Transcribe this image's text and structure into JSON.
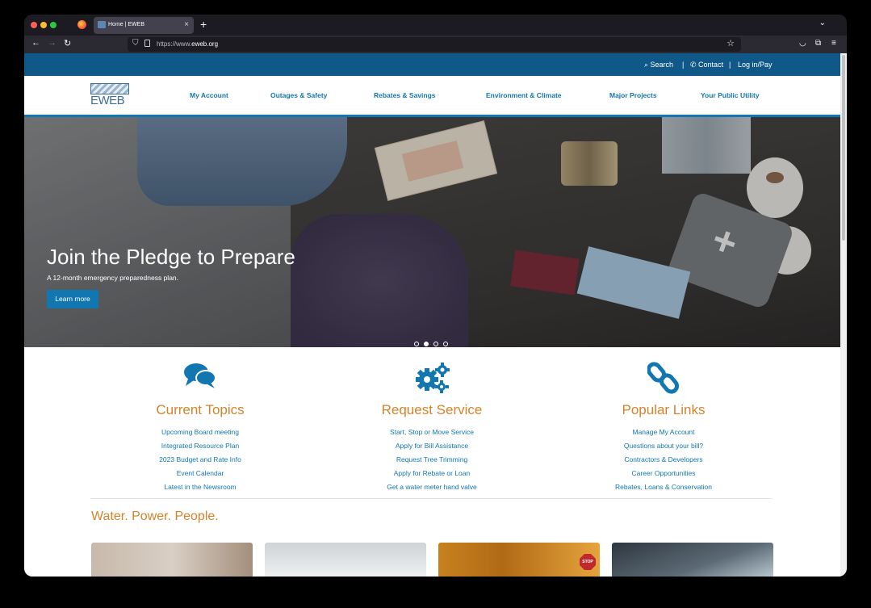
{
  "browser": {
    "tab_title": "Home | EWEB",
    "url_prefix": "https://www.",
    "url_domain": "eweb.org"
  },
  "utility_bar": {
    "search": "Search",
    "contact": "Contact",
    "login": "Log in/Pay",
    "separator": "|"
  },
  "logo": {
    "text": "EWEB"
  },
  "main_nav": [
    "My Account",
    "Outages & Safety",
    "Rebates & Savings",
    "Environment & Climate",
    "Major Projects",
    "Your Public Utility"
  ],
  "hero": {
    "title": "Join the Pledge to Prepare",
    "subtitle": "A 12-month emergency preparedness plan.",
    "button": "Learn more",
    "slide_count": 4,
    "active_slide": 2
  },
  "columns": [
    {
      "icon": "chat-bubbles-icon",
      "title": "Current Topics",
      "links": [
        "Upcoming Board meeting",
        "Integrated Resource Plan",
        "2023 Budget and Rate Info",
        "Event Calendar",
        "Latest in the Newsroom"
      ]
    },
    {
      "icon": "gears-icon",
      "title": "Request Service",
      "links": [
        "Start, Stop or Move Service",
        "Apply for Bill Assistance",
        "Request Tree Trimming",
        "Apply for Rebate or Loan",
        "Get a water meter hand valve"
      ]
    },
    {
      "icon": "chain-link-icon",
      "title": "Popular Links",
      "links": [
        "Manage My Account",
        "Questions about your bill?",
        "Contractors & Developers",
        "Career Opportunities",
        "Rebates, Loans & Conservation"
      ]
    }
  ],
  "tagline": "Water. Power. People.",
  "card3_sign": "STOP",
  "colors": {
    "brand_blue": "#1277b0",
    "utility_bar": "#0f5887",
    "accent_orange": "#d4832a"
  }
}
